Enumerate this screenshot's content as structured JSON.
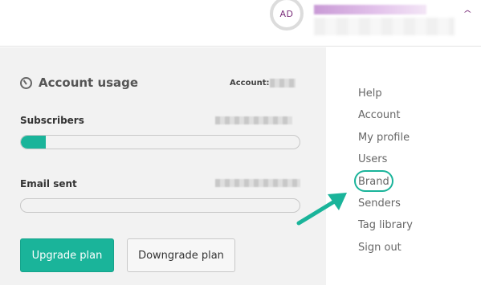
{
  "header": {
    "avatar_initials": "AD",
    "chevron_icon": "chevron-up-icon"
  },
  "usage": {
    "title": "Account usage",
    "icon": "gauge-icon",
    "account_label": "Account:",
    "subscribers_label": "Subscribers",
    "subscribers_progress": 0.09,
    "email_label": "Email sent",
    "email_progress": 0.0
  },
  "buttons": {
    "upgrade": "Upgrade plan",
    "downgrade": "Downgrade plan"
  },
  "menu": {
    "items": [
      "Help",
      "Account",
      "My profile",
      "Users",
      "Brand",
      "Senders",
      "Tag library",
      "Sign out"
    ],
    "highlighted": "Brand"
  },
  "colors": {
    "accent": "#1ab49a",
    "brand_purple": "#7a2d7a",
    "panel_bg": "#f2f2f2"
  }
}
